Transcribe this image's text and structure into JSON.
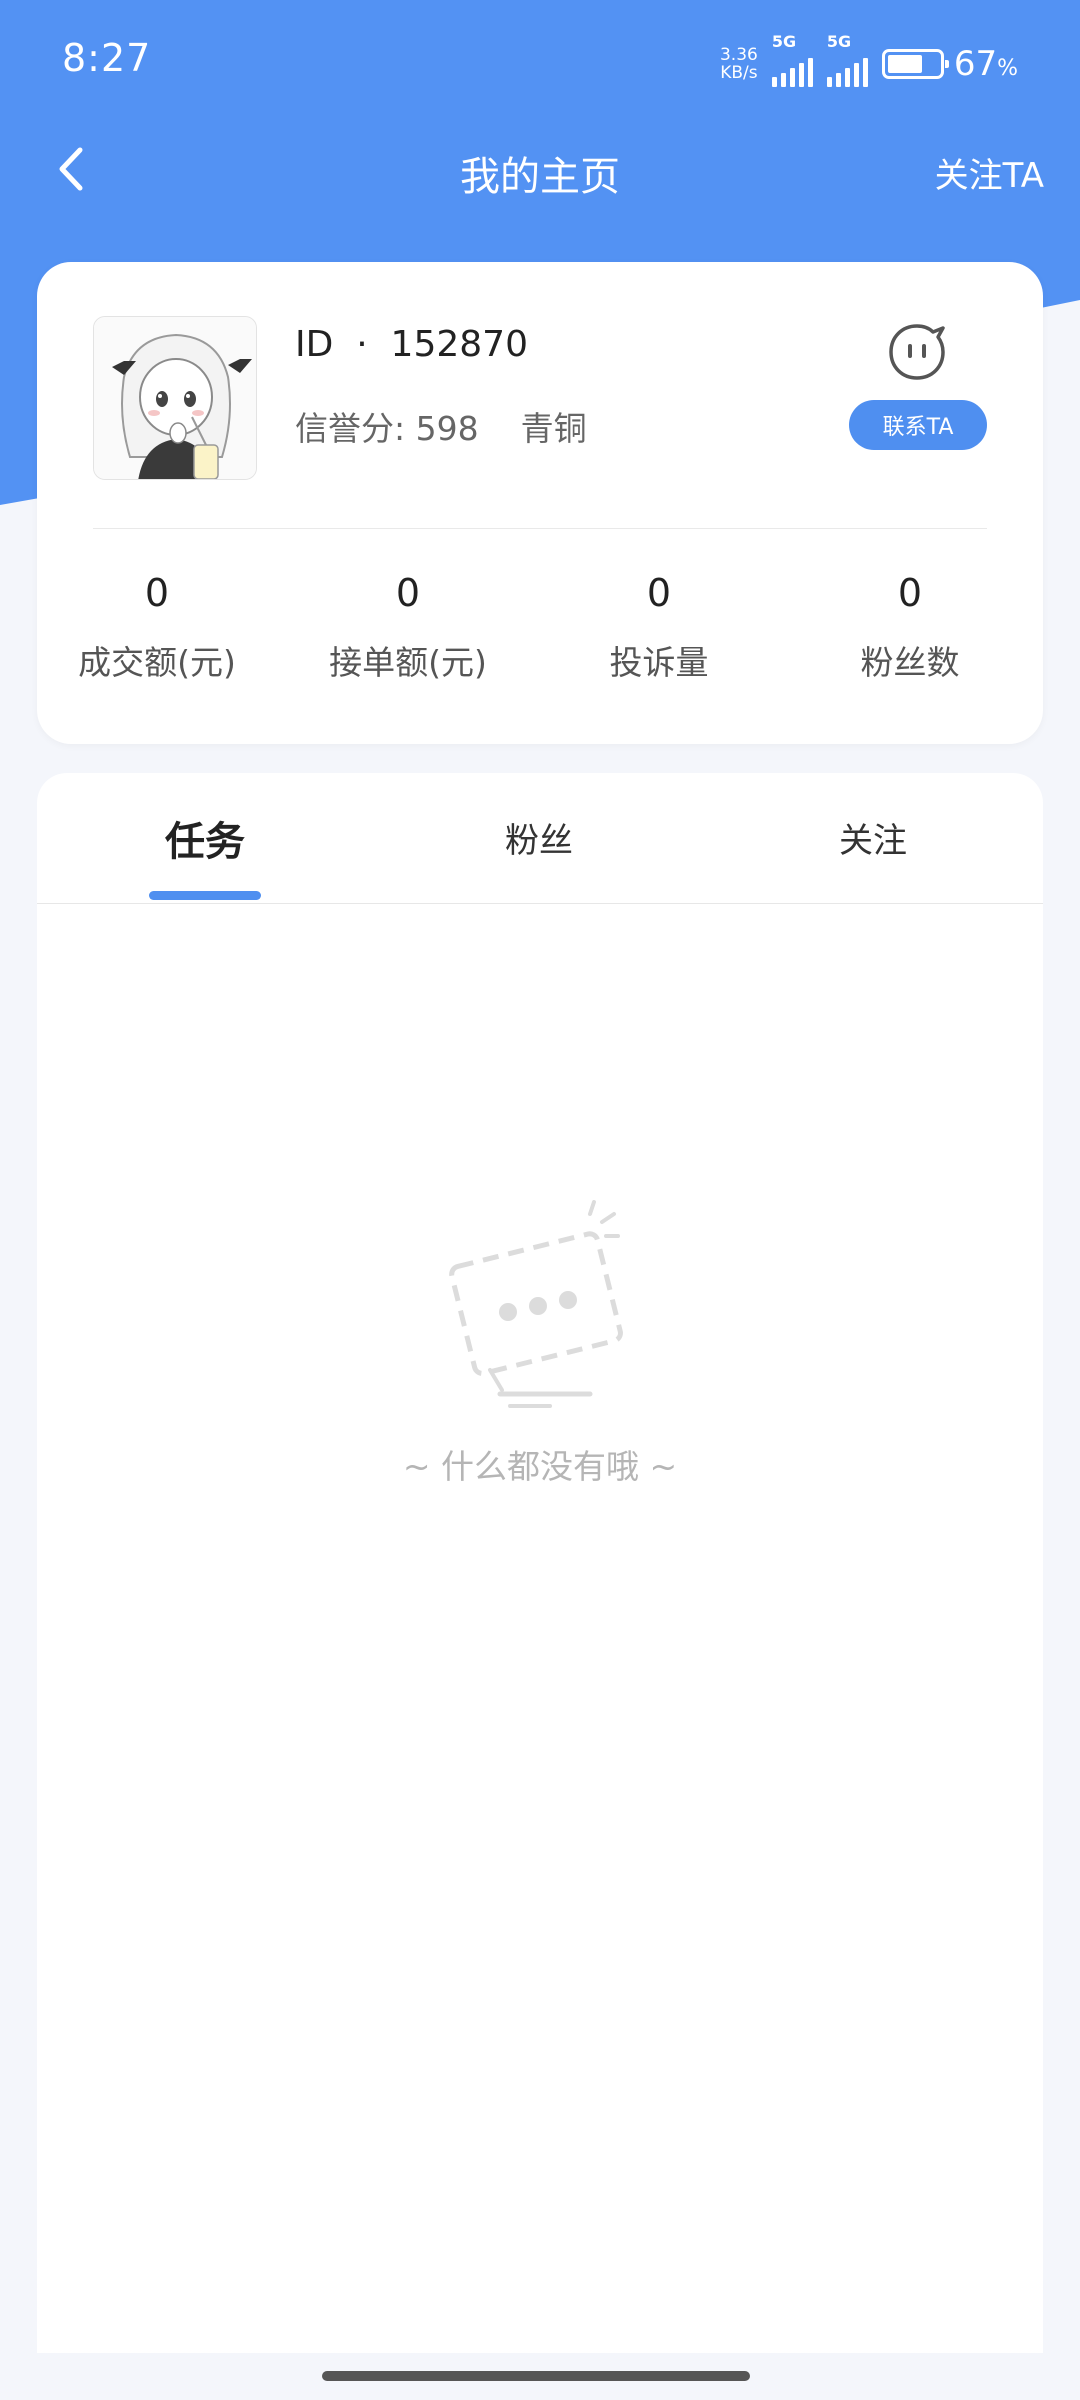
{
  "status_bar": {
    "time": "8:27",
    "net_speed_value": "3.36",
    "net_speed_unit": "KB/s",
    "signal1_label": "5G",
    "signal2_label": "5G",
    "battery_percent": "67",
    "battery_unit": "%",
    "battery_level": 0.67
  },
  "nav": {
    "back_icon": "chevron-left-icon",
    "title": "我的主页",
    "follow_label": "关注TA"
  },
  "profile": {
    "id_label": "ID  ·  152870",
    "credit_label": "信誉分: 598",
    "level": "青铜",
    "contact_button": "联系TA",
    "chat_icon": "chat-bubble-icon"
  },
  "stats": [
    {
      "value": "0",
      "label": "成交额(元)"
    },
    {
      "value": "0",
      "label": "接单额(元)"
    },
    {
      "value": "0",
      "label": "投诉量"
    },
    {
      "value": "0",
      "label": "粉丝数"
    }
  ],
  "tabs": [
    {
      "label": "任务",
      "active": true
    },
    {
      "label": "粉丝",
      "active": false
    },
    {
      "label": "关注",
      "active": false
    }
  ],
  "empty": {
    "text": "~ 什么都没有哦 ~",
    "icon": "empty-box-icon"
  },
  "colors": {
    "primary": "#4f8ff0",
    "header_bg": "#5392f3",
    "page_bg": "#f4f6fb"
  }
}
